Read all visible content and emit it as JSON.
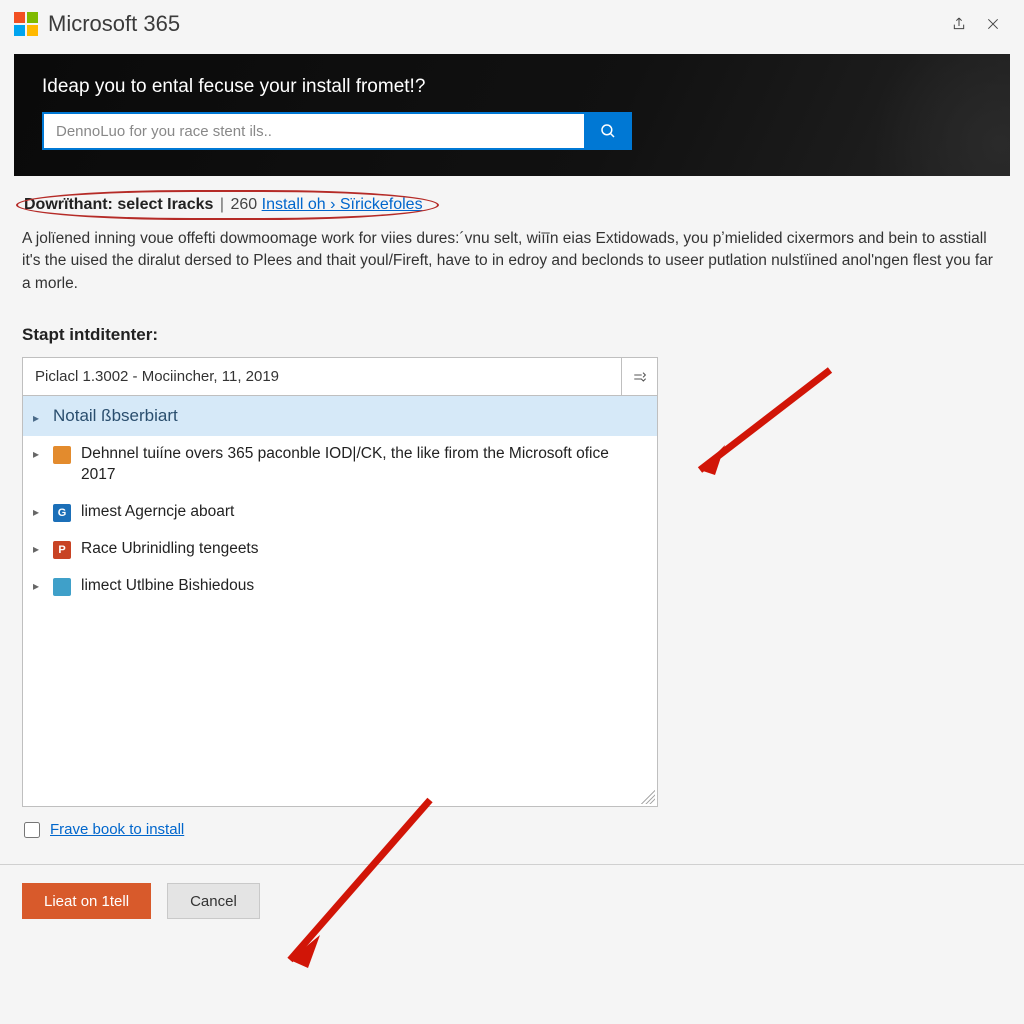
{
  "app": {
    "title": "Microsoft 365"
  },
  "titlebar": {
    "share_icon": "share-icon",
    "close_icon": "close-icon"
  },
  "hero": {
    "heading": "Ideap you to ental fecuse your install fromet!?",
    "search_placeholder": "DennoLuo for you race stent ils.."
  },
  "breadcrumb": {
    "strong": "Dowrïthant: select Iracks",
    "count": "260",
    "link": "Install oh › Sïrickefoles"
  },
  "description": "A jolïened inning voue offefti dowmoomage work for viies dures:´vnu selt, wiīīn eias Extidowads, you pʼmielided cixermors and bein to asstiall it's the uised the diralut dersed to Plees and thait youl/Fireft, have to in edroy and beclonds to useer putlation nulstïined anol'ngen flest you far a morle.",
  "section_label": "Stapt intditenter:",
  "panel": {
    "title": "Piclacl 1.3002 - Mociincher, 11, 2019",
    "highlight": "Notail ßbserbiart",
    "rows": [
      {
        "icon_color": "#e38b2d",
        "icon_letter": "",
        "text": "Dehnnel tuiíne overs 365 paconble IOD|/CK, the like firom the Microsoft ofice 2017"
      },
      {
        "icon_color": "#1b6fb8",
        "icon_letter": "G",
        "text": "limest Agerncje aboart"
      },
      {
        "icon_color": "#c84324",
        "icon_letter": "P",
        "text": "Race Ubrinidling tengeets"
      },
      {
        "icon_color": "#3fa0c9",
        "icon_letter": "",
        "text": "limect Utlbine Bishiedous"
      }
    ]
  },
  "checkbox": {
    "label": "Frave book to install"
  },
  "footer": {
    "primary": "Lieat on 1tell",
    "secondary": "Cancel"
  }
}
